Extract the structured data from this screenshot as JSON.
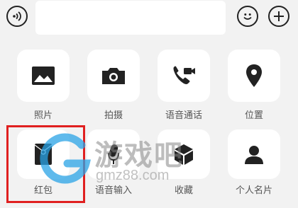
{
  "input_bar": {
    "voice_icon": "voice-wave-icon",
    "text_value": "",
    "emoji_icon": "smiley-icon",
    "more_icon": "plus-icon"
  },
  "panel": {
    "items": [
      {
        "label": "照片",
        "icon": "photo-icon"
      },
      {
        "label": "拍摄",
        "icon": "camera-icon"
      },
      {
        "label": "语音通话",
        "icon": "phone-video-icon"
      },
      {
        "label": "位置",
        "icon": "location-pin-icon"
      },
      {
        "label": "红包",
        "icon": "red-packet-icon"
      },
      {
        "label": "语音输入",
        "icon": "microphone-icon"
      },
      {
        "label": "收藏",
        "icon": "cube-icon"
      },
      {
        "label": "个人名片",
        "icon": "person-card-icon"
      }
    ]
  },
  "highlight": {
    "color": "#e02020",
    "target": "红包"
  },
  "watermark": {
    "title": "游戏吧",
    "site": "gmz88.com"
  }
}
